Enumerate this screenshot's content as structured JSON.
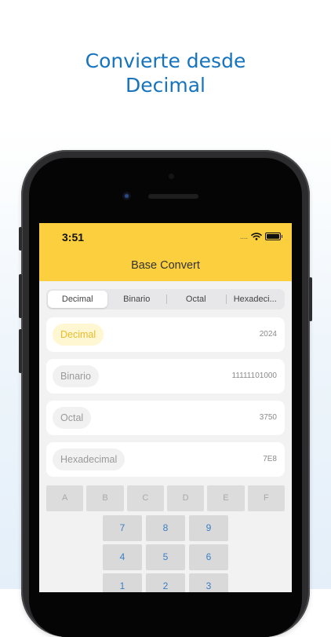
{
  "headline": {
    "line1": "Convierte desde",
    "line2": "Decimal"
  },
  "status_bar": {
    "time": "3:51",
    "signal": "....",
    "wifi_icon": "wifi-icon",
    "battery_icon": "battery-icon"
  },
  "app": {
    "title": "Base Convert"
  },
  "tabs": [
    {
      "label": "Decimal",
      "active": true
    },
    {
      "label": "Binario",
      "active": false
    },
    {
      "label": "Octal",
      "active": false
    },
    {
      "label": "Hexadeci...",
      "active": false
    }
  ],
  "fields": [
    {
      "label": "Decimal",
      "value": "2024",
      "active": true
    },
    {
      "label": "Binario",
      "value": "11111101000",
      "active": false
    },
    {
      "label": "Octal",
      "value": "3750",
      "active": false
    },
    {
      "label": "Hexadecimal",
      "value": "7E8",
      "active": false
    }
  ],
  "keypad": {
    "hex_keys": [
      "A",
      "B",
      "C",
      "D",
      "E",
      "F"
    ],
    "digit_rows": [
      [
        "7",
        "8",
        "9"
      ],
      [
        "4",
        "5",
        "6"
      ],
      [
        "1",
        "2",
        "3"
      ]
    ]
  },
  "colors": {
    "accent_yellow": "#fbcf3d",
    "headline_blue": "#1674be",
    "key_blue": "#3a7fc5"
  }
}
